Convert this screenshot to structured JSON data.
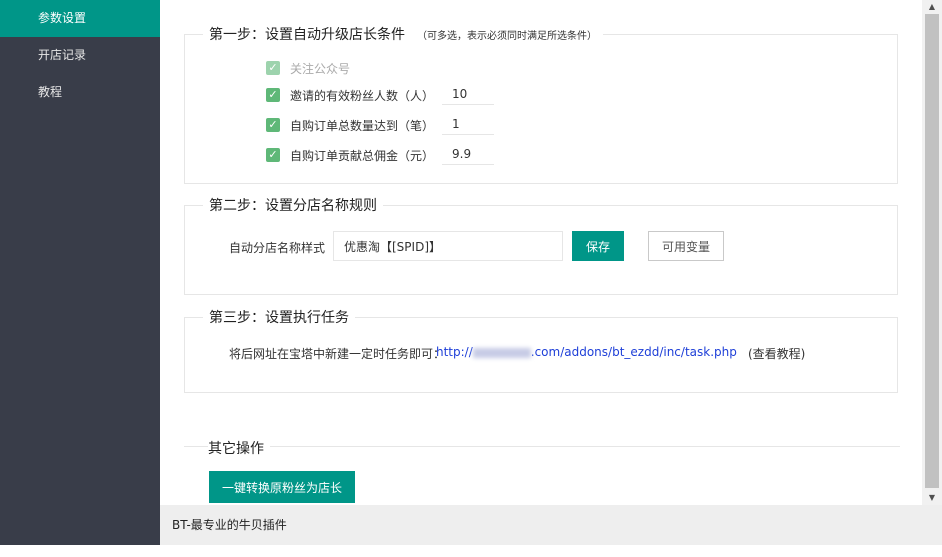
{
  "sidebar": {
    "items": [
      {
        "label": "参数设置",
        "active": true
      },
      {
        "label": "开店记录",
        "active": false
      },
      {
        "label": "教程",
        "active": false
      }
    ]
  },
  "step1": {
    "title": "第一步：设置自动升级店长条件",
    "hint": "（可多选，表示必须同时满足所选条件）",
    "options": [
      {
        "label": "关注公众号",
        "checked": true,
        "disabled": true,
        "value": ""
      },
      {
        "label": "邀请的有效粉丝人数（人）",
        "checked": true,
        "disabled": false,
        "value": "10"
      },
      {
        "label": "自购订单总数量达到（笔）",
        "checked": true,
        "disabled": false,
        "value": "1"
      },
      {
        "label": "自购订单贡献总佣金（元）",
        "checked": true,
        "disabled": false,
        "value": "9.9"
      }
    ]
  },
  "step2": {
    "title": "第二步：设置分店名称规则",
    "field_label": "自动分店名称样式",
    "field_value": "优惠淘【[SPID]】",
    "save_label": "保存",
    "vars_label": "可用变量"
  },
  "step3": {
    "title": "第三步：设置执行任务",
    "instruction": "将后网址在宝塔中新建一定时任务即可：",
    "url_prefix": "http://",
    "url_suffix": ".com/addons/bt_ezdd/inc/task.php",
    "tutorial_link": "(查看教程)"
  },
  "other": {
    "title": "其它操作",
    "convert_button": "一键转换原粉丝为店长"
  },
  "footer": {
    "text": "BT-最专业的牛贝插件"
  },
  "colors": {
    "sidebar_bg": "#393d49",
    "accent": "#009688",
    "checkbox": "#5fb878",
    "link": "#1e3fd8"
  }
}
